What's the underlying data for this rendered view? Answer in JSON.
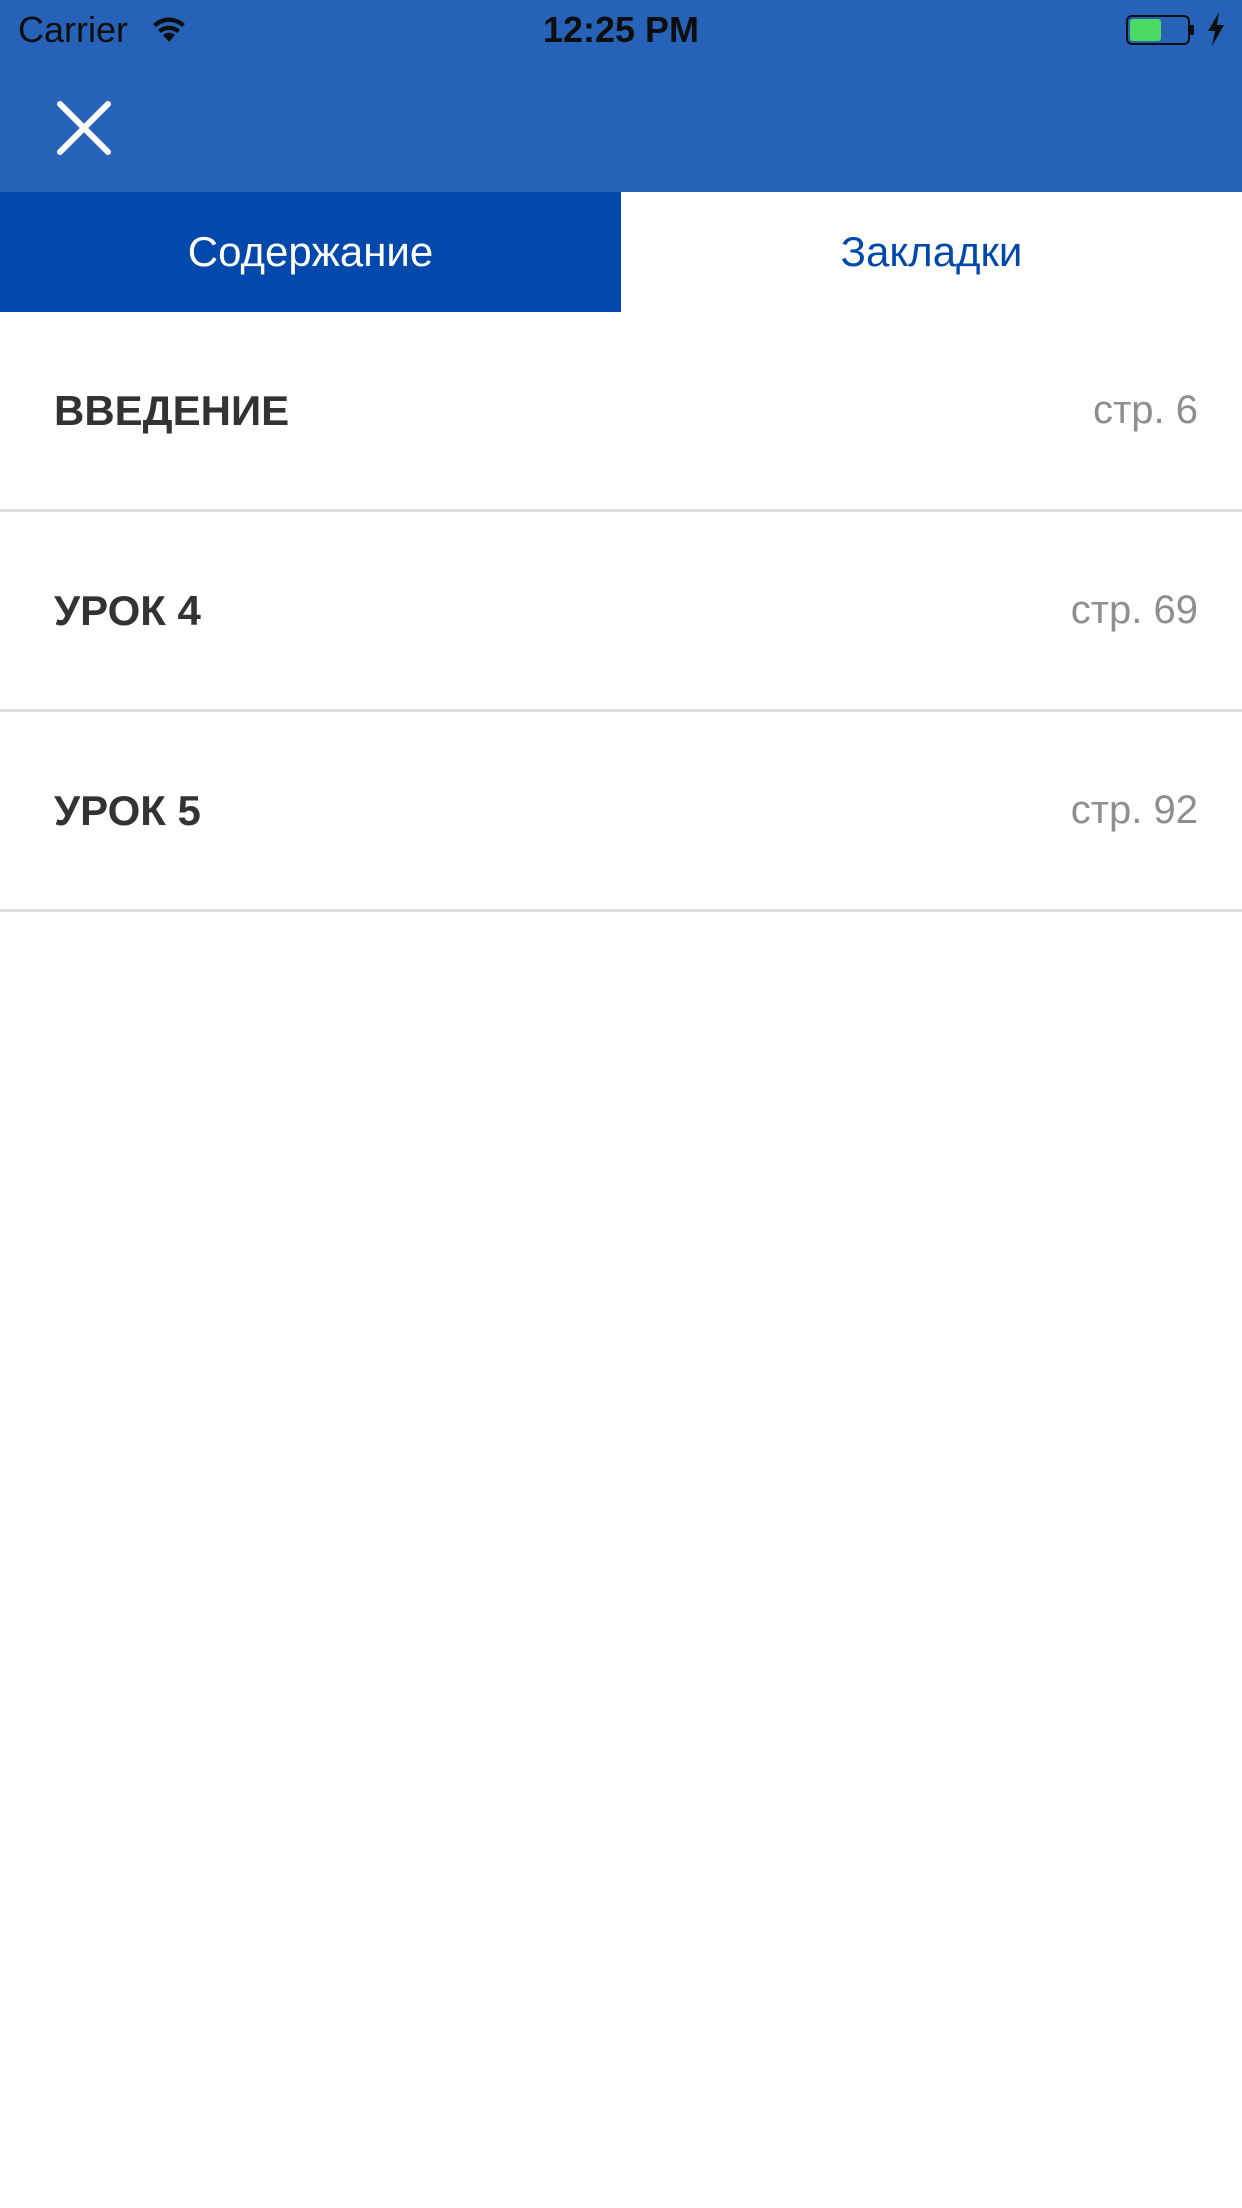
{
  "status_bar": {
    "carrier": "Carrier",
    "time": "12:25 PM",
    "wifi_icon": "wifi-icon",
    "battery_icon": "battery-charging-icon",
    "battery_level": 0.55
  },
  "nav_bar": {
    "close_icon": "close-icon",
    "background_color": "#2663b8"
  },
  "tabs": [
    {
      "label": "Содержание",
      "active": true
    },
    {
      "label": "Закладки",
      "active": false
    }
  ],
  "toc": {
    "items": [
      {
        "title": "ВВЕДЕНИЕ",
        "page": "стр. 6"
      },
      {
        "title": "УРОК 4",
        "page": "стр. 69"
      },
      {
        "title": "УРОК 5",
        "page": "стр. 92"
      }
    ]
  },
  "colors": {
    "accent": "#0348ab",
    "header": "#2663b8",
    "title_text": "#333333",
    "page_text": "#8e8e8e",
    "divider": "#dcdcdc"
  }
}
